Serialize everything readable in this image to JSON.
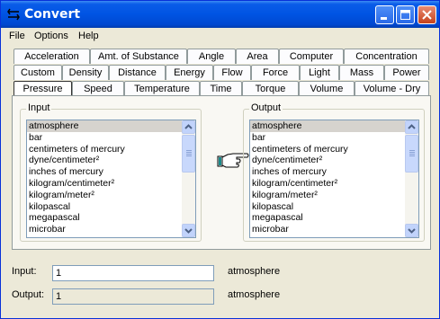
{
  "window": {
    "title": "Convert"
  },
  "menu": {
    "file": "File",
    "options": "Options",
    "help": "Help"
  },
  "tabs": {
    "row1": [
      "Acceleration",
      "Amt. of Substance",
      "Angle",
      "Area",
      "Computer",
      "Concentration"
    ],
    "row2": [
      "Custom",
      "Density",
      "Distance",
      "Energy",
      "Flow",
      "Force",
      "Light",
      "Mass",
      "Power"
    ],
    "row3": [
      "Pressure",
      "Speed",
      "Temperature",
      "Time",
      "Torque",
      "Volume",
      "Volume - Dry"
    ],
    "active": "Pressure"
  },
  "input_group": {
    "title": "Input",
    "items": [
      "atmosphere",
      "bar",
      "centimeters of mercury",
      "dyne/centimeter²",
      "inches of mercury",
      "kilogram/centimeter²",
      "kilogram/meter²",
      "kilopascal",
      "megapascal",
      "microbar"
    ],
    "selected": "atmosphere"
  },
  "output_group": {
    "title": "Output",
    "items": [
      "atmosphere",
      "bar",
      "centimeters of mercury",
      "dyne/centimeter²",
      "inches of mercury",
      "kilogram/centimeter²",
      "kilogram/meter²",
      "kilopascal",
      "megapascal",
      "microbar"
    ],
    "selected": "atmosphere"
  },
  "fields": {
    "input_label": "Input:",
    "input_value": "1",
    "input_unit": "atmosphere",
    "output_label": "Output:",
    "output_value": "1",
    "output_unit": "atmosphere"
  },
  "icons": {
    "title": "convert-icon",
    "pointer": "pointing-hand-icon",
    "minimize": "minimize-icon",
    "maximize": "maximize-icon",
    "close": "close-icon"
  },
  "colors": {
    "titlebar": "#0054e3",
    "window_bg": "#ece9d8",
    "selection": "#d6d3ce",
    "close_button": "#c6421c"
  }
}
